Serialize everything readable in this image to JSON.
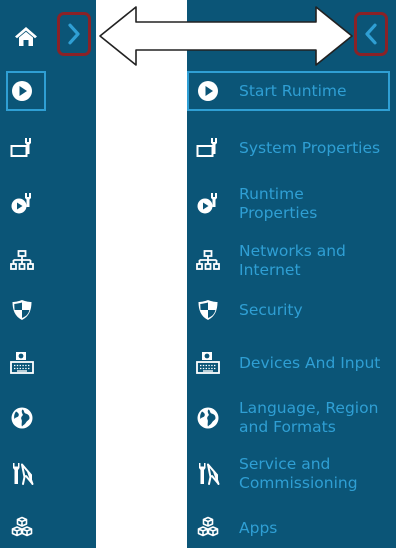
{
  "colors": {
    "panel_bg": "#0b5577",
    "accent": "#2f9fd4",
    "highlight_border": "#8a2227",
    "white": "#ffffff"
  },
  "icons": {
    "home": "home-icon",
    "expand": "chevron-right-icon",
    "collapse": "chevron-left-icon",
    "annotation": "double-headed-arrow"
  },
  "menu": {
    "items": [
      {
        "id": "start-runtime",
        "icon": "play-icon",
        "label": "Start Runtime"
      },
      {
        "id": "system-properties",
        "icon": "system-wrench-icon",
        "label": "System Properties"
      },
      {
        "id": "runtime-properties",
        "icon": "runtime-wrench-icon",
        "label": "Runtime\nProperties"
      },
      {
        "id": "networks-internet",
        "icon": "network-icon",
        "label": "Networks and\nInternet"
      },
      {
        "id": "security",
        "icon": "shield-icon",
        "label": "Security"
      },
      {
        "id": "devices-input",
        "icon": "keyboard-icon",
        "label": "Devices And Input"
      },
      {
        "id": "language-region",
        "icon": "globe-icon",
        "label": "Language, Region\nand Formats"
      },
      {
        "id": "service-commissioning",
        "icon": "tools-icon",
        "label": "Service and\nCommissioning"
      },
      {
        "id": "apps",
        "icon": "apps-icon",
        "label": "Apps"
      }
    ]
  }
}
